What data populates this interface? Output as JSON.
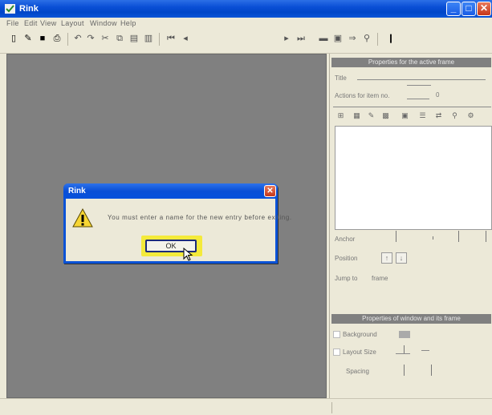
{
  "window": {
    "title": "Rink"
  },
  "menu": [
    "File",
    "Edit",
    "View",
    "Layout",
    "Window",
    "Help"
  ],
  "panels": {
    "properties_header": "Properties for the active frame",
    "title_label": "Title",
    "actions_label": "Actions for item no.",
    "actions_value": "0",
    "actions_placeholder": "",
    "anchor_label": "Anchor",
    "position_label": "Position",
    "up_arrow": "↑",
    "down_arrow": "↓",
    "jump_label": "Jump to",
    "jump_value": "frame",
    "bottom_header": "Properties of window and its frame",
    "background_label": "Background",
    "layout_label": "Layout Size",
    "spacing_label": "Spacing"
  },
  "dialog": {
    "title": "Rink",
    "message": "You must enter a name for the new entry before exiting.",
    "ok_label": "OK"
  },
  "colors": {
    "titlebar": "#0a4fd6",
    "workspace": "#808080",
    "ok_highlight": "#f4ea3a"
  }
}
